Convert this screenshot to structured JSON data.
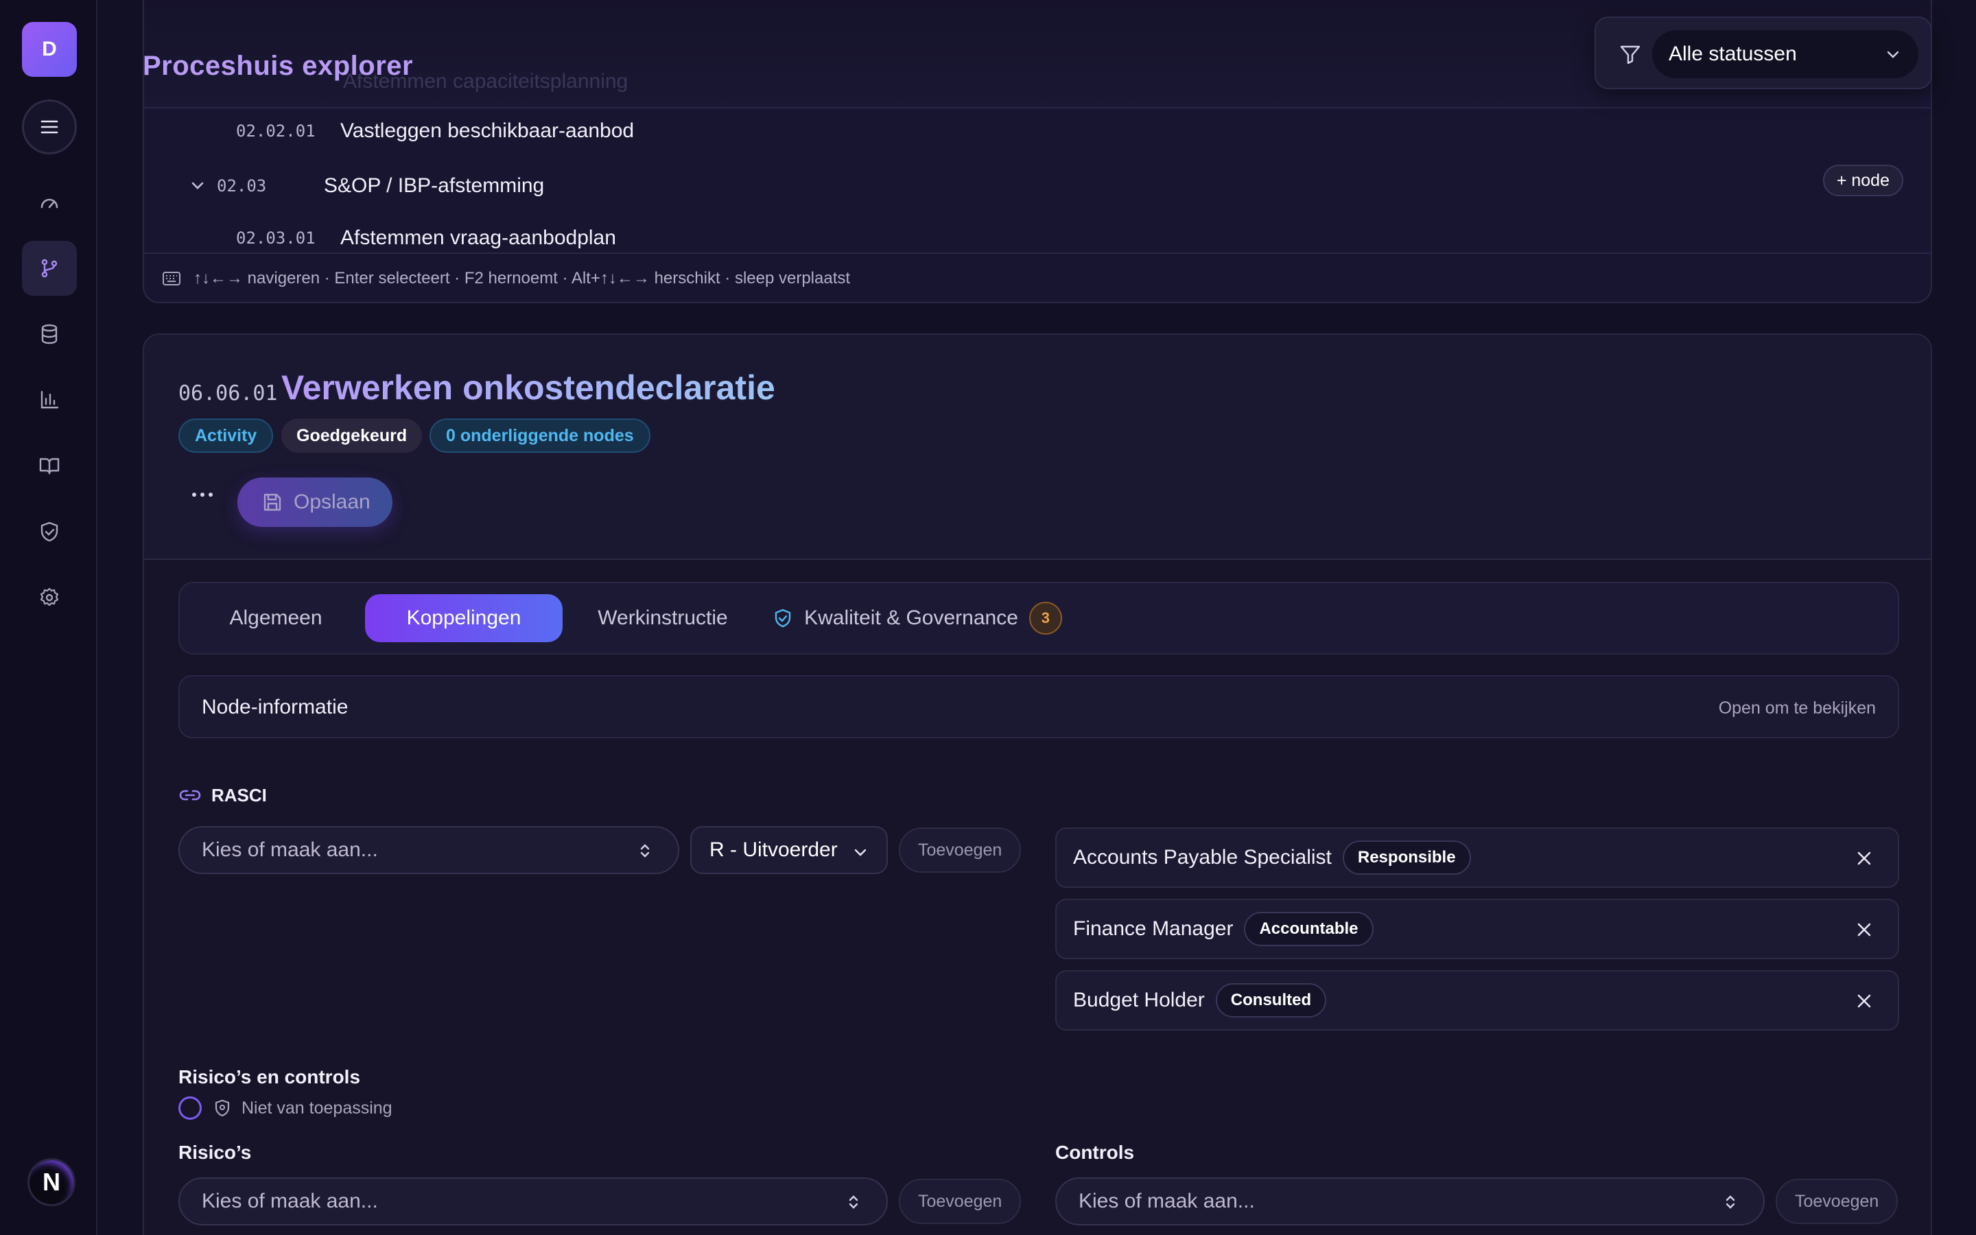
{
  "sidebar": {
    "avatar_initial": "D",
    "logo_letter": "N",
    "nav": [
      "dashboard-icon",
      "branch-icon",
      "database-icon",
      "chart-icon",
      "book-icon",
      "shield-icon",
      "gear-icon"
    ]
  },
  "explorer": {
    "title": "Proceshuis explorer",
    "ghost_text": "Afstemmen capaciteitsplanning",
    "rows": [
      {
        "code": "02.02.01",
        "label": "Vastleggen beschikbaar-aanbod"
      },
      {
        "code": "02.03",
        "label": "S&OP / IBP-afstemming"
      },
      {
        "code": "02.03.01",
        "label": "Afstemmen vraag-aanbodplan"
      }
    ],
    "add_node_label": "+ node",
    "hint": "↑↓←→ navigeren · Enter selecteert · F2 hernoemt · Alt+↑↓←→ herschikt · sleep verplaatst"
  },
  "filter": {
    "value": "Alle statussen"
  },
  "detail": {
    "code": "06.06.01",
    "title": "Verwerken onkostendeclaratie",
    "badges": {
      "type": "Activity",
      "status": "Goedgekeurd",
      "children": "0 onderliggende nodes"
    },
    "save_label": "Opslaan"
  },
  "tabs": {
    "general": "Algemeen",
    "links": "Koppelingen",
    "instruction": "Werkinstructie",
    "quality": "Kwaliteit & Governance",
    "quality_count": "3"
  },
  "node_info": {
    "title": "Node-informatie",
    "hint": "Open om te bekijken"
  },
  "rasci": {
    "title": "RASCI",
    "placeholder": "Kies of maak aan...",
    "role_value": "R - Uitvoerder",
    "add_label": "Toevoegen",
    "assignments": [
      {
        "name": "Accounts Payable Specialist",
        "role": "Responsible"
      },
      {
        "name": "Finance Manager",
        "role": "Accountable"
      },
      {
        "name": "Budget Holder",
        "role": "Consulted"
      }
    ]
  },
  "risks": {
    "section_title": "Risico’s en controls",
    "na_label": "Niet van toepassing",
    "risks_label": "Risico’s",
    "controls_label": "Controls",
    "placeholder": "Kies of maak aan...",
    "add_label": "Toevoegen"
  },
  "colors": {
    "accent": "#7b3df0",
    "accent_blue": "#4fb8f0",
    "background": "#121024"
  }
}
